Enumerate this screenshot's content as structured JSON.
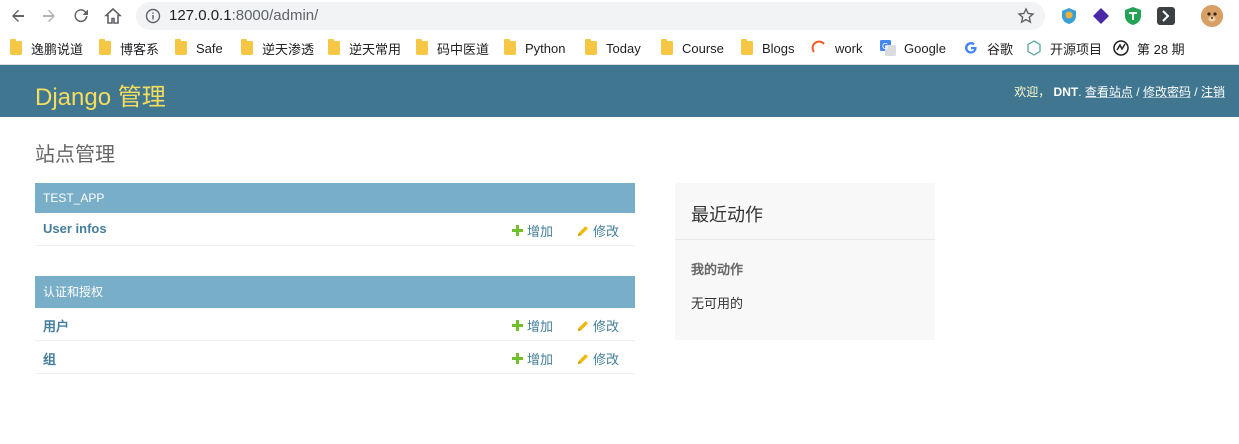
{
  "browser": {
    "url_host": "127.0.0.1",
    "url_rest": ":8000/admin/",
    "bookmarks": [
      {
        "label": "逸鹏说道"
      },
      {
        "label": "博客系"
      },
      {
        "label": "Safe"
      },
      {
        "label": "逆天渗透"
      },
      {
        "label": "逆天常用"
      },
      {
        "label": "码中医道"
      },
      {
        "label": "Python"
      },
      {
        "label": "Today"
      },
      {
        "label": "Course"
      },
      {
        "label": "Blogs"
      },
      {
        "label": "work"
      },
      {
        "label": "Google"
      },
      {
        "label": "谷歌"
      },
      {
        "label": "开源项目"
      },
      {
        "label": "第 28 期"
      }
    ]
  },
  "header": {
    "branding": "Django 管理",
    "welcome": "欢迎，",
    "username": "DNT",
    "view_site": "查看站点",
    "change_password": "修改密码",
    "logout": "注销",
    "separator": "/"
  },
  "content": {
    "title": "站点管理",
    "add_label": "增加",
    "change_label": "修改",
    "apps": [
      {
        "caption": "TEST_APP",
        "models": [
          {
            "name": "User infos"
          }
        ]
      },
      {
        "caption": "认证和授权",
        "models": [
          {
            "name": "用户"
          },
          {
            "name": "组"
          }
        ]
      }
    ]
  },
  "sidebar": {
    "title": "最近动作",
    "subtitle": "我的动作",
    "empty": "无可用的"
  },
  "colors": {
    "header_bg": "#417690",
    "branding": "#f5dd5d",
    "caption_bg": "#79aec8",
    "link": "#447e9b",
    "addlink": "#70bf2b",
    "changelink": "#efb80b"
  }
}
